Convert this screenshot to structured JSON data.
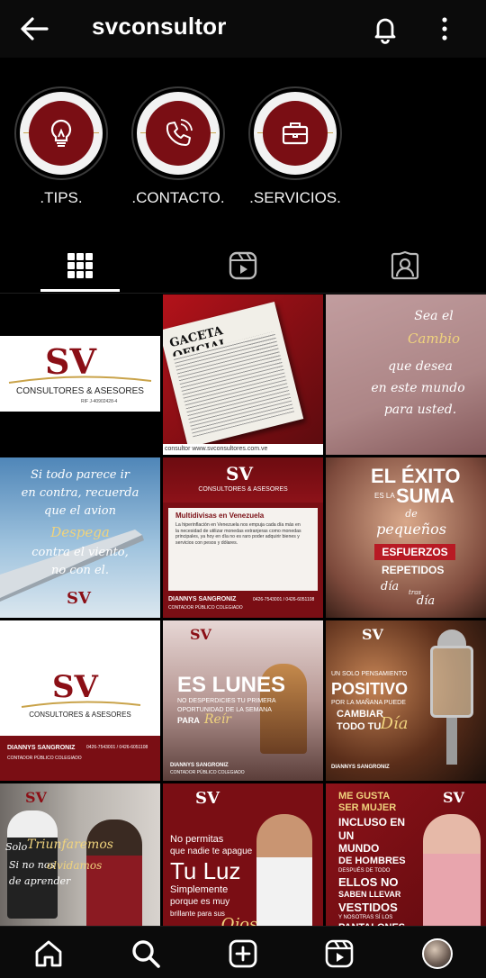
{
  "header": {
    "username": "svconsultor"
  },
  "highlights": [
    {
      "label": ".TIPS.",
      "icon": "lightbulb-icon"
    },
    {
      "label": ".CONTACTO.",
      "icon": "phone-icon"
    },
    {
      "label": ".SERVICIOS.",
      "icon": "briefcase-icon"
    }
  ],
  "tabs": [
    {
      "name": "grid-tab",
      "icon": "grid-icon",
      "active": true
    },
    {
      "name": "reels-tab",
      "icon": "reels-icon",
      "active": false
    },
    {
      "name": "tagged-tab",
      "icon": "tagged-icon",
      "active": false
    }
  ],
  "posts": {
    "p1": {
      "brand": "CONSULTORES & ASESORES",
      "rif": "RIF J-40902428-4"
    },
    "p2": {
      "title": "GACETA OFICIAL",
      "footer": "consultor  www.svconsultores.com.ve"
    },
    "p3": {
      "lines": [
        "Sea el",
        "Cambio",
        "que desea",
        "en este mundo",
        "para usted."
      ]
    },
    "p4": {
      "lines": [
        "Si todo parece ir",
        "en contra, recuerda",
        "que el avion",
        "Despega",
        "contra el viento,",
        "no con el."
      ]
    },
    "p5": {
      "brand": "CONSULTORES & ASESORES",
      "headline": "Multidivisas en Venezuela",
      "body": "La hiperinflación en Venezuela nos empuja cada día más en la necesidad de utilizar monedas extranjeras como monedas principales, ya hoy en día no es raro poder adquirir bienes y servicios con pesos y dólares.",
      "name": "DIANNYS SANGRONIZ",
      "role": "CONTADOR PÚBLICO COLEGIADO",
      "phone": "0426-7543001 / 0426-6051108"
    },
    "p6": {
      "lines": [
        "EL ÉXITO",
        "ES LA",
        "SUMA",
        "de",
        "pequeños",
        "ESFUERZOS",
        "REPETIDOS",
        "día",
        "tras",
        "día"
      ]
    },
    "p7": {
      "brand": "CONSULTORES & ASESORES",
      "name": "DIANNYS SANGRONIZ",
      "role": "CONTADOR PÚBLICO COLEGIADO",
      "phone": "0426-7543001 / 0426-6051108"
    },
    "p8": {
      "lines": [
        "ES LUNES",
        "NO DESPERDICIES TU PRIMERA",
        "OPORTUNIDAD DE LA SEMANA",
        "PARA",
        "Reír"
      ],
      "name": "DIANNYS SANGRONIZ",
      "role": "CONTADOR PÚBLICO COLEGIADO"
    },
    "p9": {
      "lines": [
        "UN SOLO PENSAMIENTO",
        "POSITIVO",
        "POR LA MAÑANA PUEDE",
        "CAMBIAR",
        "TODO TU",
        "Día"
      ],
      "name": "DIANNYS SANGRONIZ"
    },
    "p10": {
      "lines": [
        "Solo",
        "Triunfaremos",
        "Si no nos",
        "olvidamos",
        "de aprender"
      ]
    },
    "p11": {
      "lines": [
        "No permitas",
        "que nadie te apague",
        "Tu Luz",
        "Simplemente",
        "porque es muy",
        "brillante para sus",
        "Ojos"
      ]
    },
    "p12": {
      "lines": [
        "ME GUSTA",
        "SER MUJER",
        "INCLUSO EN",
        "UN",
        "MUNDO",
        "DE HOMBRES",
        "DESPUÉS DE TODO",
        "ELLOS NO",
        "SABEN LLEVAR",
        "VESTIDOS",
        "Y NOSOTRAS SÍ LOS",
        "PANTALONES."
      ]
    }
  },
  "bottom_nav": [
    {
      "name": "home-button",
      "icon": "home-icon"
    },
    {
      "name": "search-button",
      "icon": "search-icon"
    },
    {
      "name": "create-button",
      "icon": "plus-square-icon"
    },
    {
      "name": "reels-button",
      "icon": "reels-icon"
    },
    {
      "name": "profile-button",
      "icon": "avatar"
    }
  ],
  "colors": {
    "brand_red": "#8b0f16",
    "gold": "#c9a34a",
    "background": "#000000"
  }
}
